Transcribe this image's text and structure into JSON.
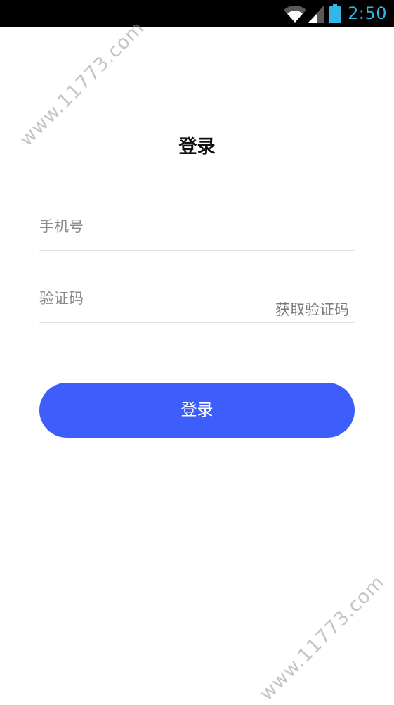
{
  "status_bar": {
    "time": "2:50",
    "icons": [
      "wifi-icon",
      "signal-icon",
      "battery-icon"
    ],
    "clock_color": "#33b5e5"
  },
  "page": {
    "title": "登录"
  },
  "form": {
    "phone_placeholder": "手机号",
    "code_placeholder": "验证码",
    "get_code_label": "获取验证码",
    "submit_label": "登录"
  },
  "watermark": {
    "text": "www.11773.com"
  },
  "colors": {
    "accent": "#3d5efb",
    "placeholder": "#8a8a8a"
  }
}
